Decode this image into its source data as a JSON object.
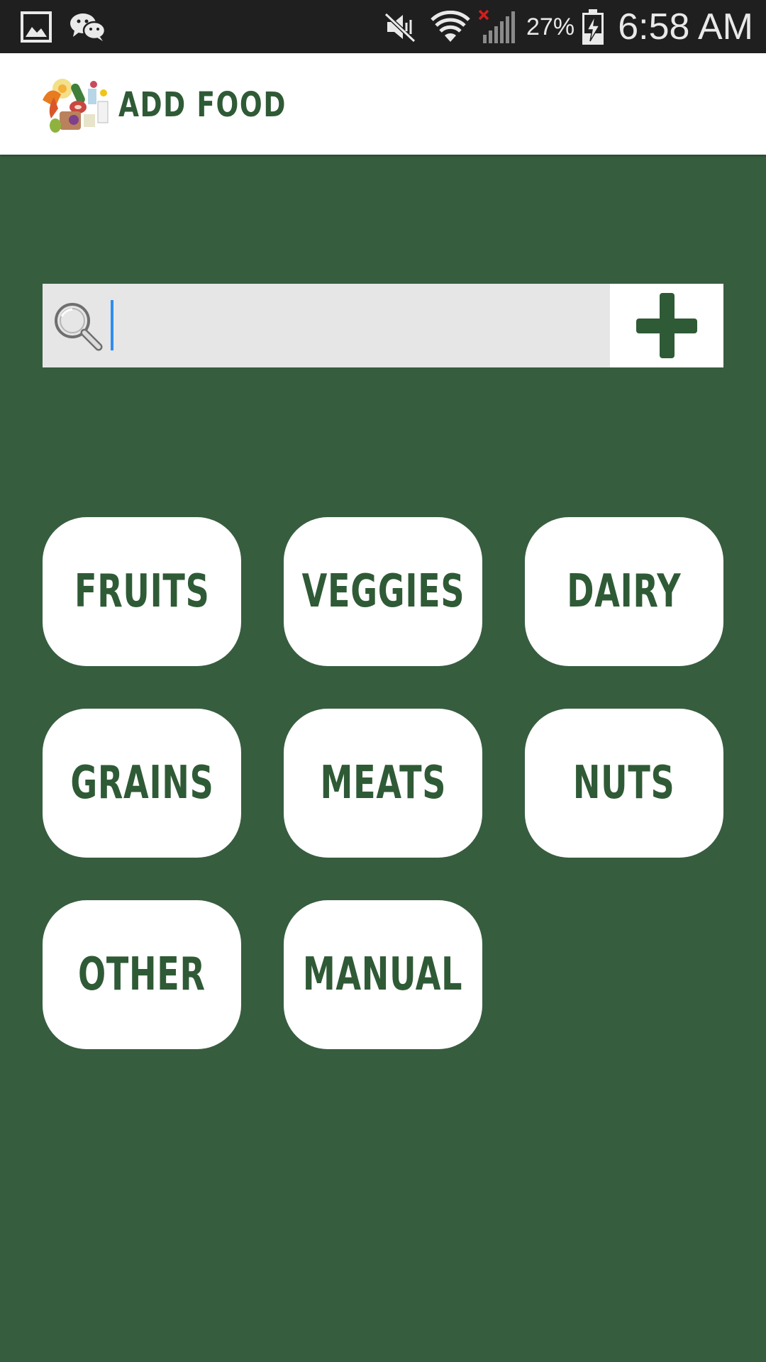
{
  "status_bar": {
    "icons": [
      "gallery-icon",
      "wechat-icon",
      "mute-icon",
      "wifi-icon",
      "signal-icon",
      "battery-charging-icon"
    ],
    "battery_percent": "27%",
    "time": "6:58 AM"
  },
  "app_bar": {
    "title": "ADD FOOD",
    "logo": "food-collage-logo"
  },
  "search": {
    "value": "",
    "placeholder": "",
    "icon": "search-icon",
    "add_icon": "plus-icon"
  },
  "categories": [
    {
      "label": "FRUITS"
    },
    {
      "label": "VEGGIES"
    },
    {
      "label": "DAIRY"
    },
    {
      "label": "GRAINS"
    },
    {
      "label": "MEATS"
    },
    {
      "label": "NUTS"
    },
    {
      "label": "OTHER"
    },
    {
      "label": "MANUAL"
    }
  ],
  "colors": {
    "background": "#375d3f",
    "accent_text": "#2f5a36",
    "button_bg": "#ffffff",
    "search_bg": "#e6e6e6",
    "cursor": "#2f8df2",
    "status_bar": "#1f1f1f"
  }
}
